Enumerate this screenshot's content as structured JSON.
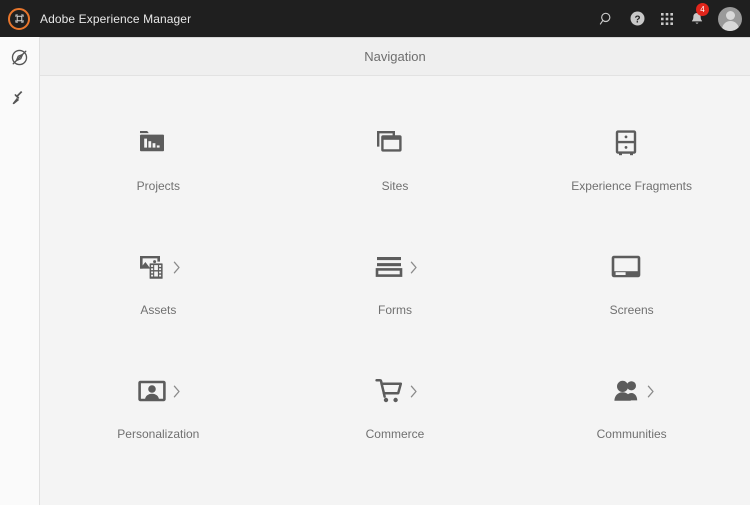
{
  "topbar": {
    "logo_icon": "aem-logo-icon",
    "brand_color": "#e8762c",
    "title": "Adobe Experience Manager",
    "background": "#1f1f1f",
    "actions": [
      {
        "name": "search-icon",
        "label": "Search"
      },
      {
        "name": "help-icon",
        "label": "Help"
      },
      {
        "name": "solutions-grid-icon",
        "label": "Solutions"
      },
      {
        "name": "notifications-bell-icon",
        "label": "Notifications",
        "badge": "4",
        "badge_color": "#e1251b"
      }
    ],
    "avatar": {
      "name": "user-avatar",
      "label": "User"
    }
  },
  "rail": {
    "items": [
      {
        "name": "navigation-compass-icon",
        "label": "Navigation"
      },
      {
        "name": "tools-hammer-icon",
        "label": "Tools"
      }
    ]
  },
  "page": {
    "header_title": "Navigation",
    "background": "#f4f4f4",
    "header_background": "#efefef",
    "label_color": "#707070",
    "icon_color": "#5c5c5c"
  },
  "tiles": [
    {
      "label": "Projects",
      "icon": "projects-folder-chart-icon",
      "chevron": false
    },
    {
      "label": "Sites",
      "icon": "sites-windows-icon",
      "chevron": false
    },
    {
      "label": "Experience Fragments",
      "icon": "experience-fragments-cabinet-icon",
      "chevron": false
    },
    {
      "label": "Assets",
      "icon": "assets-image-film-icon",
      "chevron": true
    },
    {
      "label": "Forms",
      "icon": "forms-lines-icon",
      "chevron": true
    },
    {
      "label": "Screens",
      "icon": "screens-monitor-icon",
      "chevron": false
    },
    {
      "label": "Personalization",
      "icon": "personalization-portrait-icon",
      "chevron": true
    },
    {
      "label": "Commerce",
      "icon": "commerce-cart-icon",
      "chevron": true
    },
    {
      "label": "Communities",
      "icon": "communities-people-icon",
      "chevron": true
    }
  ]
}
